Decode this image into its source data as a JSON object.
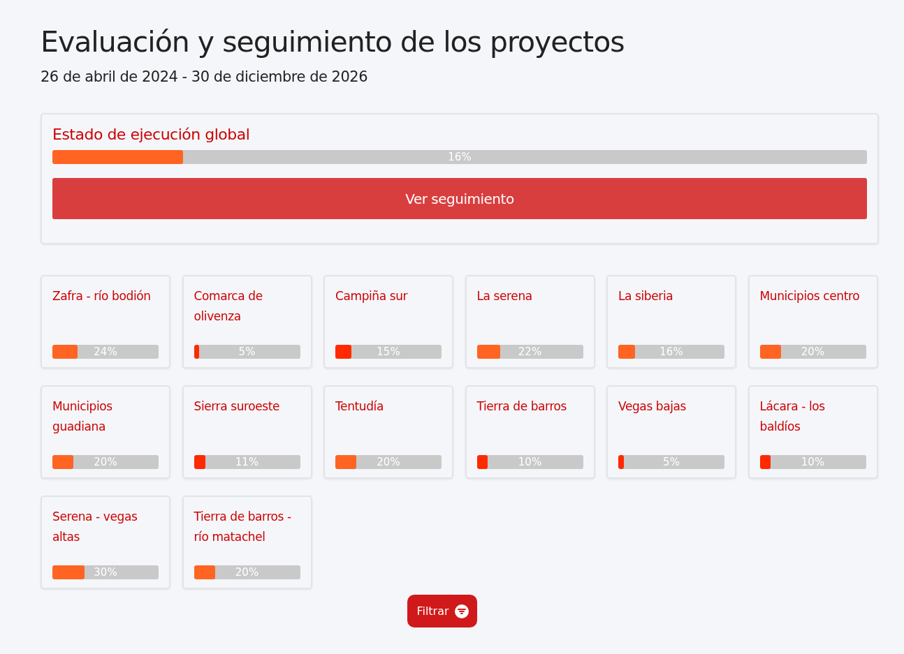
{
  "title": "Evaluación y seguimiento de los proyectos",
  "date_range": "26 de abril de 2024 - 30 de diciembre de 2026",
  "global": {
    "heading": "Estado de ejecución global",
    "level": 0.16,
    "reading": "16%",
    "color": "#ff6422",
    "button": "Ver seguimiento"
  },
  "projects": [
    {
      "name": "Zafra - río bodión",
      "level": 0.24,
      "reading": "24%",
      "color": "#ff6422"
    },
    {
      "name": "Comarca de olivenza",
      "level": 0.05,
      "reading": "5%",
      "color": "#ff2a00"
    },
    {
      "name": "Campiña sur",
      "level": 0.15,
      "reading": "15%",
      "color": "#ff2a00"
    },
    {
      "name": "La serena",
      "level": 0.22,
      "reading": "22%",
      "color": "#ff6422"
    },
    {
      "name": "La siberia",
      "level": 0.16,
      "reading": "16%",
      "color": "#ff6422"
    },
    {
      "name": "Municipios centro",
      "level": 0.2,
      "reading": "20%",
      "color": "#ff6422"
    },
    {
      "name": "Municipios guadiana",
      "level": 0.2,
      "reading": "20%",
      "color": "#ff6422"
    },
    {
      "name": "Sierra suroeste",
      "level": 0.11,
      "reading": "11%",
      "color": "#ff2a00"
    },
    {
      "name": "Tentudía",
      "level": 0.2,
      "reading": "20%",
      "color": "#ff6422"
    },
    {
      "name": "Tierra de barros",
      "level": 0.1,
      "reading": "10%",
      "color": "#ff2a00"
    },
    {
      "name": "Vegas bajas",
      "level": 0.05,
      "reading": "5%",
      "color": "#ff2a00"
    },
    {
      "name": "Lácara - los baldíos",
      "level": 0.1,
      "reading": "10%",
      "color": "#ff2a00"
    },
    {
      "name": "Serena - vegas altas",
      "level": 0.3,
      "reading": "30%",
      "color": "#ff6422"
    },
    {
      "name": "Tierra de barros - río matachel",
      "level": 0.2,
      "reading": "20%",
      "color": "#ff6422"
    }
  ],
  "filter_button": "Filtrar"
}
